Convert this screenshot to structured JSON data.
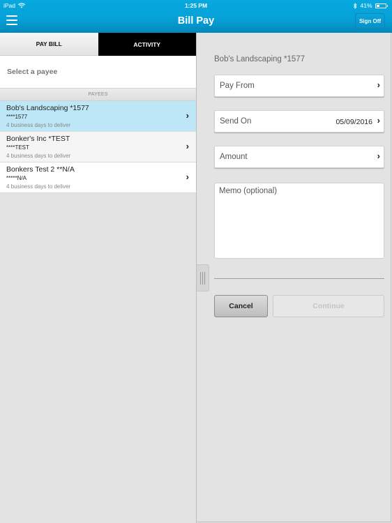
{
  "status_bar": {
    "device": "iPad",
    "time": "1:25 PM",
    "battery_percent": "41%",
    "battery_level": 0.41
  },
  "header": {
    "title": "Bill Pay",
    "menu_icon": "hamburger-menu-icon",
    "sign_off_label": "Sign Off"
  },
  "tabs": [
    {
      "label": "PAY BILL",
      "active": true
    },
    {
      "label": "ACTIVITY",
      "active": false
    }
  ],
  "left_pane": {
    "prompt": "Select a payee",
    "section_header": "PAYEES",
    "payees": [
      {
        "name": "Bob's Landscaping *1577",
        "account": "****1577",
        "delivery": "4 business days to deliver",
        "selected": true
      },
      {
        "name": "Bonker's Inc *TEST",
        "account": "****TEST",
        "delivery": "4 business days to deliver",
        "selected": false
      },
      {
        "name": "Bonkers Test 2 **N/A",
        "account": "*****N/A",
        "delivery": "4 business days to deliver",
        "selected": false
      }
    ]
  },
  "right_pane": {
    "payee_title": "Bob's Landscaping *1577",
    "fields": {
      "pay_from": {
        "label": "Pay From",
        "value": ""
      },
      "send_on": {
        "label": "Send On",
        "value": "05/09/2016"
      },
      "amount": {
        "label": "Amount",
        "value": ""
      }
    },
    "memo_placeholder": "Memo (optional)",
    "cancel_label": "Cancel",
    "continue_label": "Continue",
    "continue_enabled": false
  },
  "colors": {
    "header_blue": "#05a0d6",
    "selected_row": "#bde7f6",
    "background": "#e3e3e3"
  }
}
